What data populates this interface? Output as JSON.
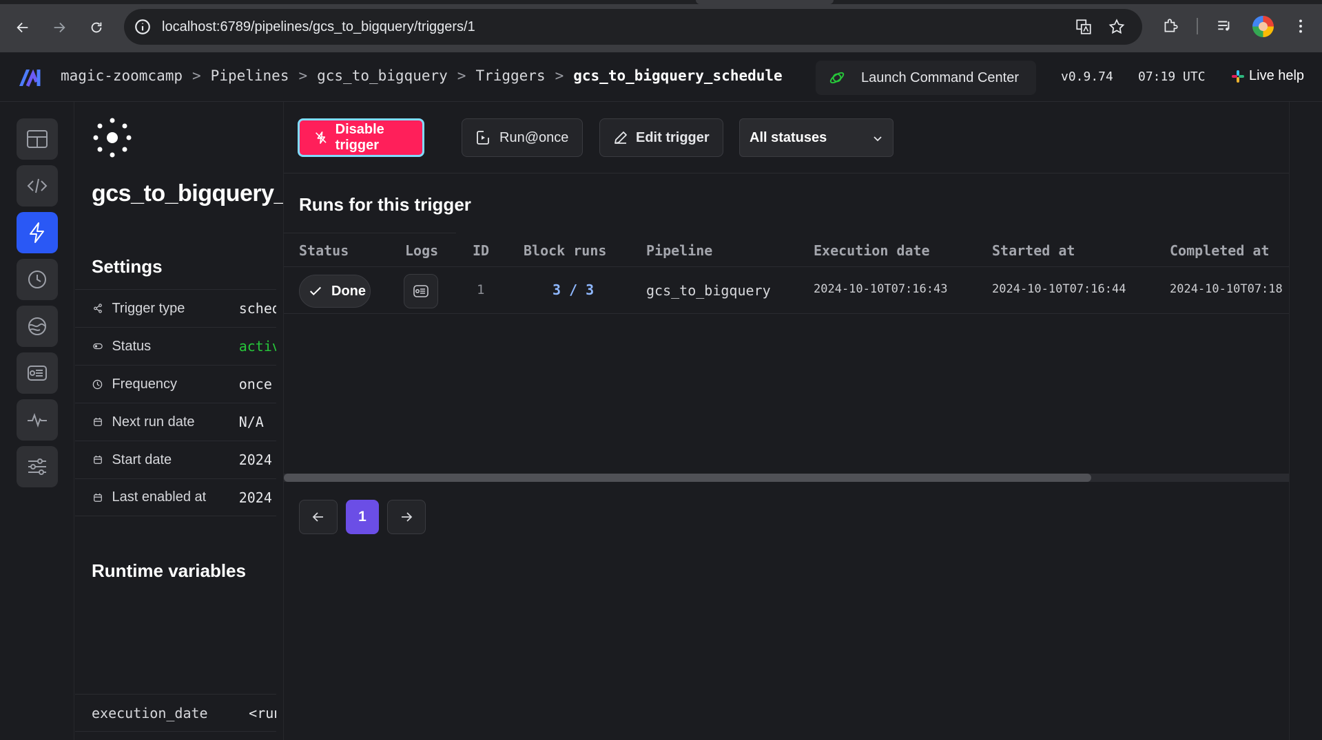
{
  "browser": {
    "url": "localhost:6789/pipelines/gcs_to_bigquery/triggers/1"
  },
  "header": {
    "breadcrumbs": [
      "magic-zoomcamp",
      "Pipelines",
      "gcs_to_bigquery",
      "Triggers"
    ],
    "current": "gcs_to_bigquery_schedule",
    "command_center": "Launch Command Center",
    "version": "v0.9.74",
    "time": "07:19 UTC",
    "live_help": "Live help"
  },
  "panel": {
    "title": "gcs_to_bigquery_schedule",
    "settings_title": "Settings",
    "settings": [
      {
        "label": "Trigger type",
        "value": "schedule",
        "icon": "share-icon"
      },
      {
        "label": "Status",
        "value": "active",
        "icon": "toggle-icon"
      },
      {
        "label": "Frequency",
        "value": "once",
        "icon": "clock-icon"
      },
      {
        "label": "Next run date",
        "value": "N/A",
        "icon": "calendar-icon"
      },
      {
        "label": "Start date",
        "value": "2024",
        "icon": "calendar-icon"
      },
      {
        "label": "Last enabled at",
        "value": "2024",
        "icon": "calendar-icon"
      }
    ],
    "runtime_title": "Runtime variables",
    "runtime_variables": [
      {
        "key": "execution_date",
        "value": "<run_datetime>"
      }
    ]
  },
  "toolbar": {
    "disable_label": "Disable trigger",
    "run_once_label": "Run@once",
    "edit_label": "Edit trigger",
    "status_filter": "All statuses"
  },
  "runs": {
    "title": "Runs for this trigger",
    "columns": [
      "Status",
      "Logs",
      "ID",
      "Block runs",
      "Pipeline",
      "Execution date",
      "Started at",
      "Completed at"
    ],
    "rows": [
      {
        "status": "Done",
        "id": "1",
        "block_runs": "3 / 3",
        "pipeline": "gcs_to_bigquery",
        "execution_date": "2024-10-10T07:16:43",
        "started_at": "2024-10-10T07:16:44",
        "completed_at": "2024-10-10T07:18"
      }
    ]
  },
  "pagination": {
    "current_page": "1"
  },
  "colors": {
    "disable_button": "#ff1f5a",
    "active_rail": "#2a58f5",
    "page_active": "#6b4ee6",
    "status_active": "#27c63a",
    "block_runs_link": "#8fb8ff"
  }
}
